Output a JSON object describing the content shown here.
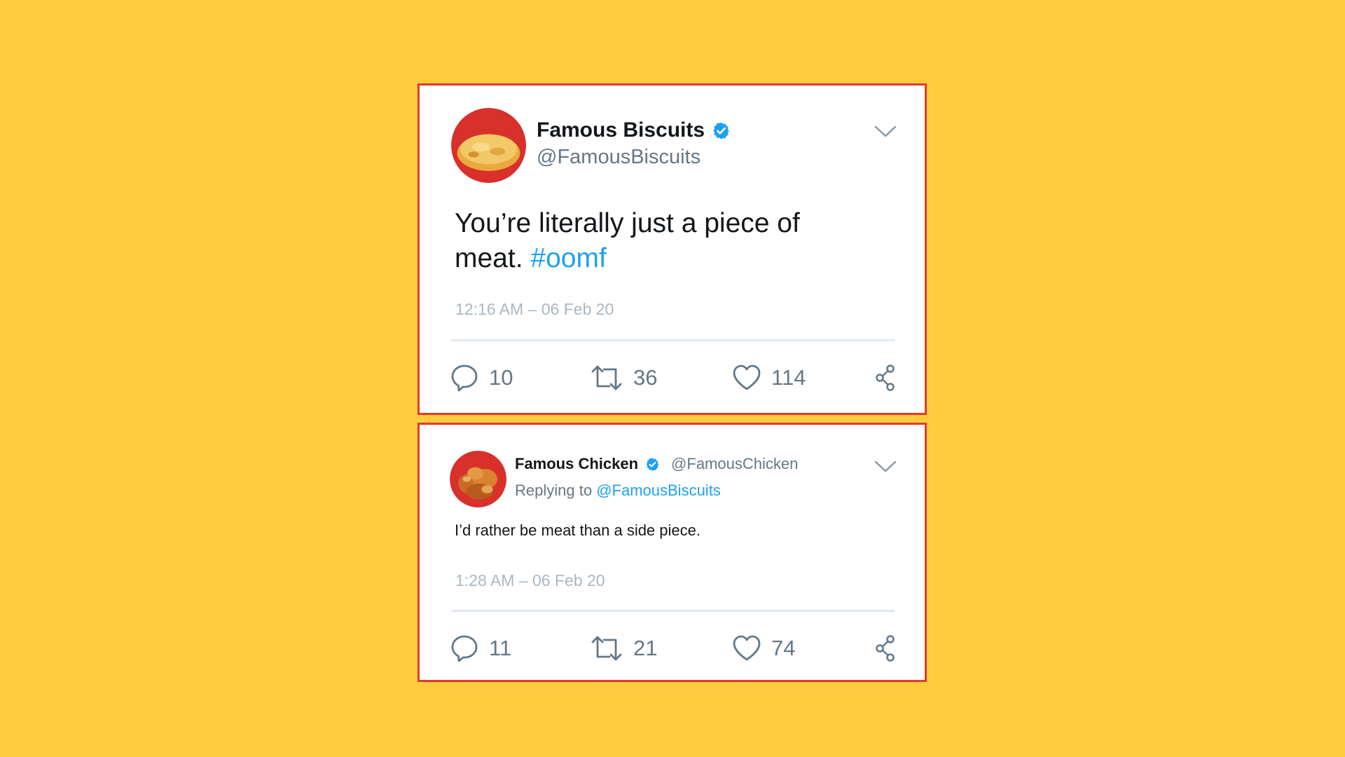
{
  "colors": {
    "background": "#FECC3E",
    "card_border": "#E8372A",
    "link": "#1DA1F2",
    "verified": "#1DA1F2",
    "muted_text": "#657786",
    "timestamp": "#AAB8C2"
  },
  "tweets": [
    {
      "display_name": "Famous Biscuits",
      "handle": "@FamousBiscuits",
      "verified": true,
      "avatar": "biscuit-avatar",
      "text": "You’re literally just a piece of meat.",
      "hashtag": "#oomf",
      "timestamp": "12:16 AM – 06 Feb 20",
      "counts": {
        "replies": "10",
        "retweets": "36",
        "likes": "114"
      },
      "icons": [
        "chevron-down-icon",
        "reply-icon",
        "retweet-icon",
        "heart-icon",
        "share-icon",
        "verified-badge-icon"
      ]
    },
    {
      "display_name": "Famous Chicken",
      "handle": "@FamousChicken",
      "verified": true,
      "avatar": "chicken-avatar",
      "replying_prefix": "Replying to",
      "replying_to": "@FamousBiscuits",
      "text": "I’d rather be meat than a side piece.",
      "timestamp": "1:28 AM – 06 Feb 20",
      "counts": {
        "replies": "11",
        "retweets": "21",
        "likes": "74"
      },
      "icons": [
        "chevron-down-icon",
        "reply-icon",
        "retweet-icon",
        "heart-icon",
        "share-icon",
        "verified-badge-icon"
      ]
    }
  ]
}
